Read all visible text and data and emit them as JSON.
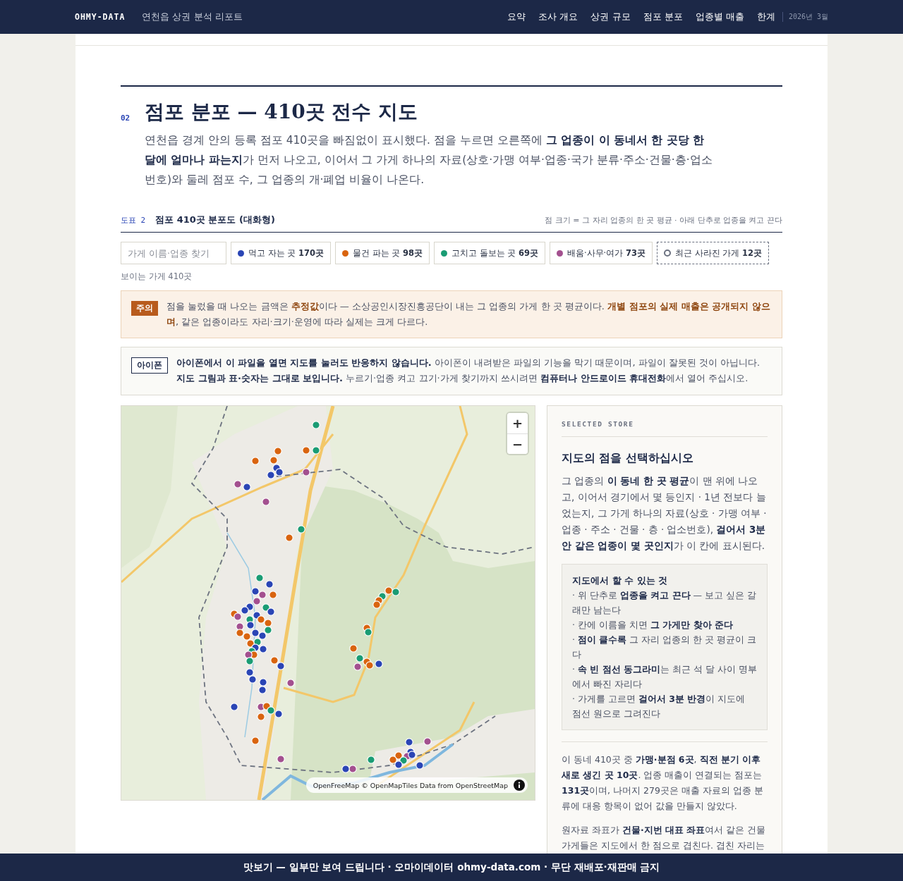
{
  "nav": {
    "brand": "OHMY-DATA",
    "title": "연천읍 상권 분석 리포트",
    "items": [
      "요약",
      "조사 개요",
      "상권 규모",
      "점포 분포",
      "업종별 매출",
      "한계"
    ],
    "date": "2026년 3월"
  },
  "section": {
    "number": "02",
    "title": "점포 분포 — 410곳 전수 지도",
    "lead": "연천읍 경계 안의 등록 점포 410곳을 빠짐없이 표시했다. 점을 누르면 오른쪽에 **그 업종이 이 동네서 한 곳당 한 달에 얼마나 파는지**가 먼저 나오고, 이어서 그 가게 하나의 자료(상호·가맹 여부·업종·국가 분류·주소·건물·층·업소번호)와 둘레 점포 수, 그 업종의 개·폐업 비율이 나온다."
  },
  "figure": {
    "label": "도표 2",
    "title": "점포 410곳 분포도 (대화형)",
    "note": "점 크기 = 그 자리 업종의 한 곳 평균 · 아래 단추로 업종을 켜고 끈다"
  },
  "search": {
    "placeholder": "가게 이름·업종 찾기"
  },
  "filters": [
    {
      "kind": "category",
      "label": "먹고 자는 곳",
      "count": "170곳",
      "color": "#2a45b5"
    },
    {
      "kind": "category",
      "label": "물건 파는 곳",
      "count": "98곳",
      "color": "#d9640f"
    },
    {
      "kind": "category",
      "label": "고치고 돌보는 곳",
      "count": "69곳",
      "color": "#1a9c74"
    },
    {
      "kind": "category",
      "label": "배움·사무·여가",
      "count": "73곳",
      "color": "#a3508f"
    },
    {
      "kind": "closed",
      "label": "최근 사라진 가게",
      "count": "12곳"
    }
  ],
  "visible_count": "보이는 가게 410곳",
  "notices": [
    {
      "kind": "caution",
      "tag": "주의",
      "text": "점을 눌렀을 때 나오는 금액은 **추정값**이다 — 소상공인시장진흥공단이 내는 그 업종의 가게 한 곳 평균이다. **개별 점포의 실제 매출은 공개되지 않으며**, 같은 업종이라도 자리·크기·운영에 따라 실제는 크게 다르다."
    },
    {
      "kind": "info",
      "tag": "아이폰",
      "text": "**아이폰에서 이 파일을 열면 지도를 눌러도 반응하지 않습니다.** 아이폰이 내려받은 파일의 기능을 막기 때문이며, 파일이 잘못된 것이 아닙니다. **지도 그림과 표·숫자는 그대로 보입니다.** 누르기·업종 켜고 끄기·가게 찾기까지 쓰시려면 **컴퓨터나 안드로이드 휴대전화**에서 열어 주십시오."
    }
  ],
  "map": {
    "zoom_in": "+",
    "zoom_out": "−",
    "attribution": "OpenFreeMap © OpenMapTiles Data from OpenStreetMap"
  },
  "panel": {
    "eyebrow": "SELECTED STORE",
    "heading": "지도의 점을 선택하십시오",
    "intro": "그 업종의 **이 동네 한 곳 평균**이 맨 위에 나오고, 이어서 경기에서 몇 등인지 · 1년 전보다 늘었는지, 그 가게 하나의 자료(상호 · 가맹 여부 · 업종 · 주소 · 건물 · 층 · 업소번호), **걸어서 3분 안 같은 업종이 몇 곳인지**가 이 칸에 표시된다.",
    "howto": {
      "title": "지도에서 할 수 있는 것",
      "items": [
        "· 위 단추로 **업종을 켜고 끈다** — 보고 싶은 갈래만 남는다",
        "· 칸에 이름을 치면 **그 가게만 찾아 준다**",
        "· **점이 클수록** 그 자리 업종의 한 곳 평균이 크다",
        "· **속 빈 점선 동그라미**는 최근 석 달 사이 명부에서 빠진 자리다",
        "· 가게를 고르면 **걸어서 3분 반경**이 지도에 점선 원으로 그려진다"
      ]
    },
    "paragraphs": [
      "이 동네 410곳 중 **가맹·분점 6곳**, **직전 분기 이후 새로 생긴 곳 10곳**. 업종 매출이 연결되는 점포는 **131곳**이며, 나머지 279곳은 매출 자료의 업종 분류에 대응 항목이 없어 값을 만들지 않았다.",
      "원자료 좌표가 **건물·지번 대표 좌표**여서 같은 건물 가게들은 지도에서 한 점으로 겹친다. 겹친 자리는"
    ]
  },
  "footer": "맛보기 — 일부만 보여 드립니다 · 오마이데이터 ohmy-data.com · 무단 재배포·재판매 금지"
}
